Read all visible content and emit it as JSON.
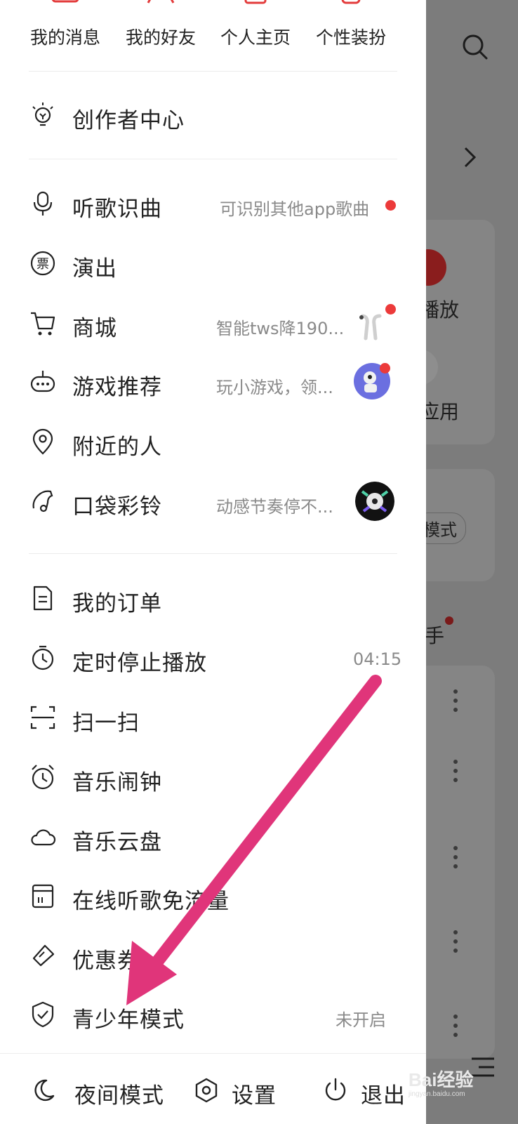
{
  "quick_actions": [
    {
      "label": "我的消息",
      "icon": "mail-icon"
    },
    {
      "label": "我的好友",
      "icon": "friends-icon"
    },
    {
      "label": "个人主页",
      "icon": "profile-page-icon"
    },
    {
      "label": "个性装扮",
      "icon": "dress-up-icon"
    }
  ],
  "creator": {
    "label": "创作者中心",
    "icon": "lightbulb-icon"
  },
  "group1": [
    {
      "label": "听歌识曲",
      "sub": "可识别其他app歌曲",
      "icon": "mic-recognize-icon",
      "dot": true
    },
    {
      "label": "演出",
      "sub": "",
      "icon": "ticket-icon"
    },
    {
      "label": "商城",
      "sub": "智能tws降190...",
      "icon": "cart-icon",
      "dot": true,
      "thumb": "earbuds-thumbnail"
    },
    {
      "label": "游戏推荐",
      "sub": "玩小游戏，领...",
      "icon": "gamepad-icon",
      "dot": true,
      "thumb": "game-avatar-thumbnail"
    },
    {
      "label": "附近的人",
      "sub": "",
      "icon": "location-pin-icon"
    },
    {
      "label": "口袋彩铃",
      "sub": "动感节奏停不...",
      "icon": "ringtone-icon",
      "thumb": "ringtone-cover-thumbnail"
    }
  ],
  "group2": [
    {
      "label": "我的订单",
      "sub": "",
      "icon": "order-document-icon"
    },
    {
      "label": "定时停止播放",
      "sub": "04:15",
      "icon": "timer-icon"
    },
    {
      "label": "扫一扫",
      "sub": "",
      "icon": "scan-icon"
    },
    {
      "label": "音乐闹钟",
      "sub": "",
      "icon": "alarm-clock-icon"
    },
    {
      "label": "音乐云盘",
      "sub": "",
      "icon": "cloud-icon"
    },
    {
      "label": "在线听歌免流量",
      "sub": "",
      "icon": "sim-card-icon"
    },
    {
      "label": "优惠券",
      "sub": "",
      "icon": "coupon-icon"
    },
    {
      "label": "青少年模式",
      "sub": "未开启",
      "icon": "shield-check-icon"
    }
  ],
  "bottom_bar": {
    "night_mode": "夜间模式",
    "settings": "设置",
    "logout": "退出"
  },
  "background": {
    "play_label": "播放",
    "apps_label": "应用",
    "mode_label": "模式",
    "hand_label": "手"
  },
  "watermark": {
    "brand": "Bai",
    "brand2": "经验",
    "url": "jingyan.baidu.com"
  },
  "colors": {
    "accent": "#e33b3b",
    "arrow": "#e0357a",
    "dot": "#ec3a3a"
  }
}
